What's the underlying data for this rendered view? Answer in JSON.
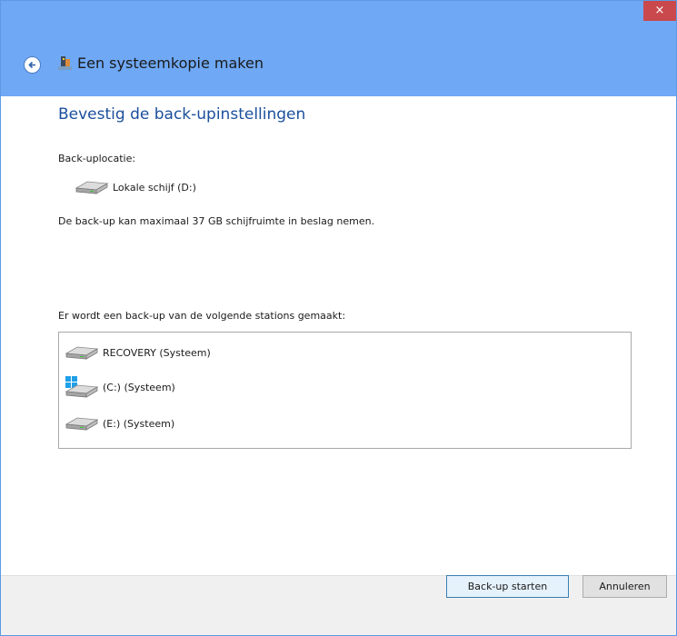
{
  "window": {
    "title": "Een systeemkopie maken",
    "close_glyph": "×"
  },
  "main": {
    "heading": "Bevestig de back-upinstellingen",
    "location_label": "Back-uplocatie:",
    "location_drive": "Lokale schijf (D:)",
    "space_text": "De back-up kan maximaal 37 GB schijfruimte in beslag nemen.",
    "drives_label": "Er wordt een back-up van de volgende stations gemaakt:",
    "drives": [
      {
        "label": "RECOVERY (Systeem)",
        "icon": "hard-drive-icon"
      },
      {
        "label": "(C:) (Systeem)",
        "icon": "windows-drive-icon"
      },
      {
        "label": "(E:) (Systeem)",
        "icon": "hard-drive-icon"
      }
    ]
  },
  "buttons": {
    "start": "Back-up starten",
    "cancel": "Annuleren"
  },
  "colors": {
    "titlebar": "#6fa8f5",
    "heading": "#1b4f9c",
    "close": "#c9494d"
  }
}
